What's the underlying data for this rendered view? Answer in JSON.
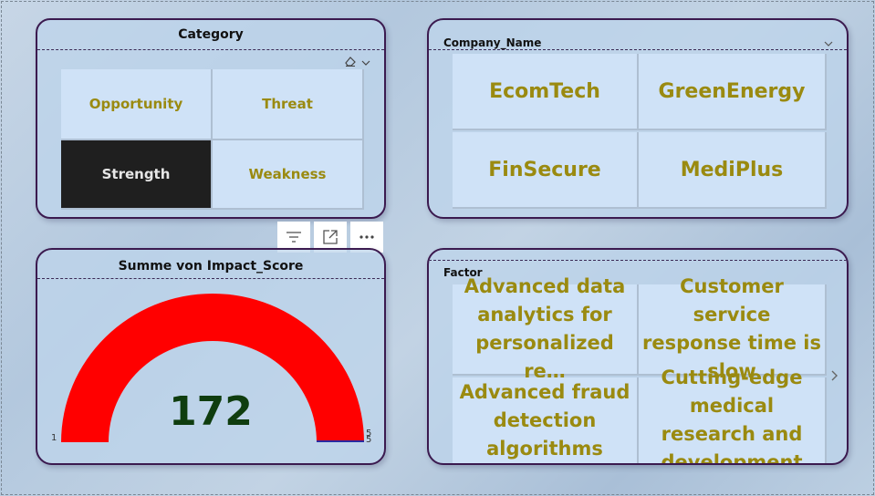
{
  "category_card": {
    "title": "Category",
    "items": [
      {
        "label": "Opportunity",
        "selected": false
      },
      {
        "label": "Threat",
        "selected": false
      },
      {
        "label": "Strength",
        "selected": true
      },
      {
        "label": "Weakness",
        "selected": false
      }
    ],
    "icons": [
      "eraser-icon",
      "chevron-down-icon"
    ]
  },
  "visual_toolbar": {
    "icons": [
      "filter-icon",
      "focus-mode-icon",
      "more-options-icon"
    ]
  },
  "company_card": {
    "title": "Company_Name",
    "items": [
      {
        "label": "EcomTech"
      },
      {
        "label": "GreenEnergy"
      },
      {
        "label": "FinSecure"
      },
      {
        "label": "MediPlus"
      }
    ],
    "icons": [
      "chevron-down-icon"
    ]
  },
  "gauge_card": {
    "title": "Summe von Impact_Score",
    "value": "172",
    "min_label": "1",
    "max_label": "5",
    "target_label": "5",
    "fill_fraction": 1.0,
    "fill_color": "#ff0000"
  },
  "factor_card": {
    "title": "Factor",
    "items": [
      {
        "label": "Advanced data analytics for personalized re…"
      },
      {
        "label": "Customer service response time is slow"
      },
      {
        "label": "Advanced fraud detection algorithms"
      },
      {
        "label": "Cutting-edge medical research and development"
      }
    ],
    "icons": [
      "chevron-right-icon"
    ]
  },
  "colors": {
    "border": "#3b1a4f",
    "tile_bg": "#cfe2f7",
    "tile_text": "#9a8a10",
    "selected_bg": "#1f1f1f",
    "gauge_value": "#0f3d0f"
  }
}
